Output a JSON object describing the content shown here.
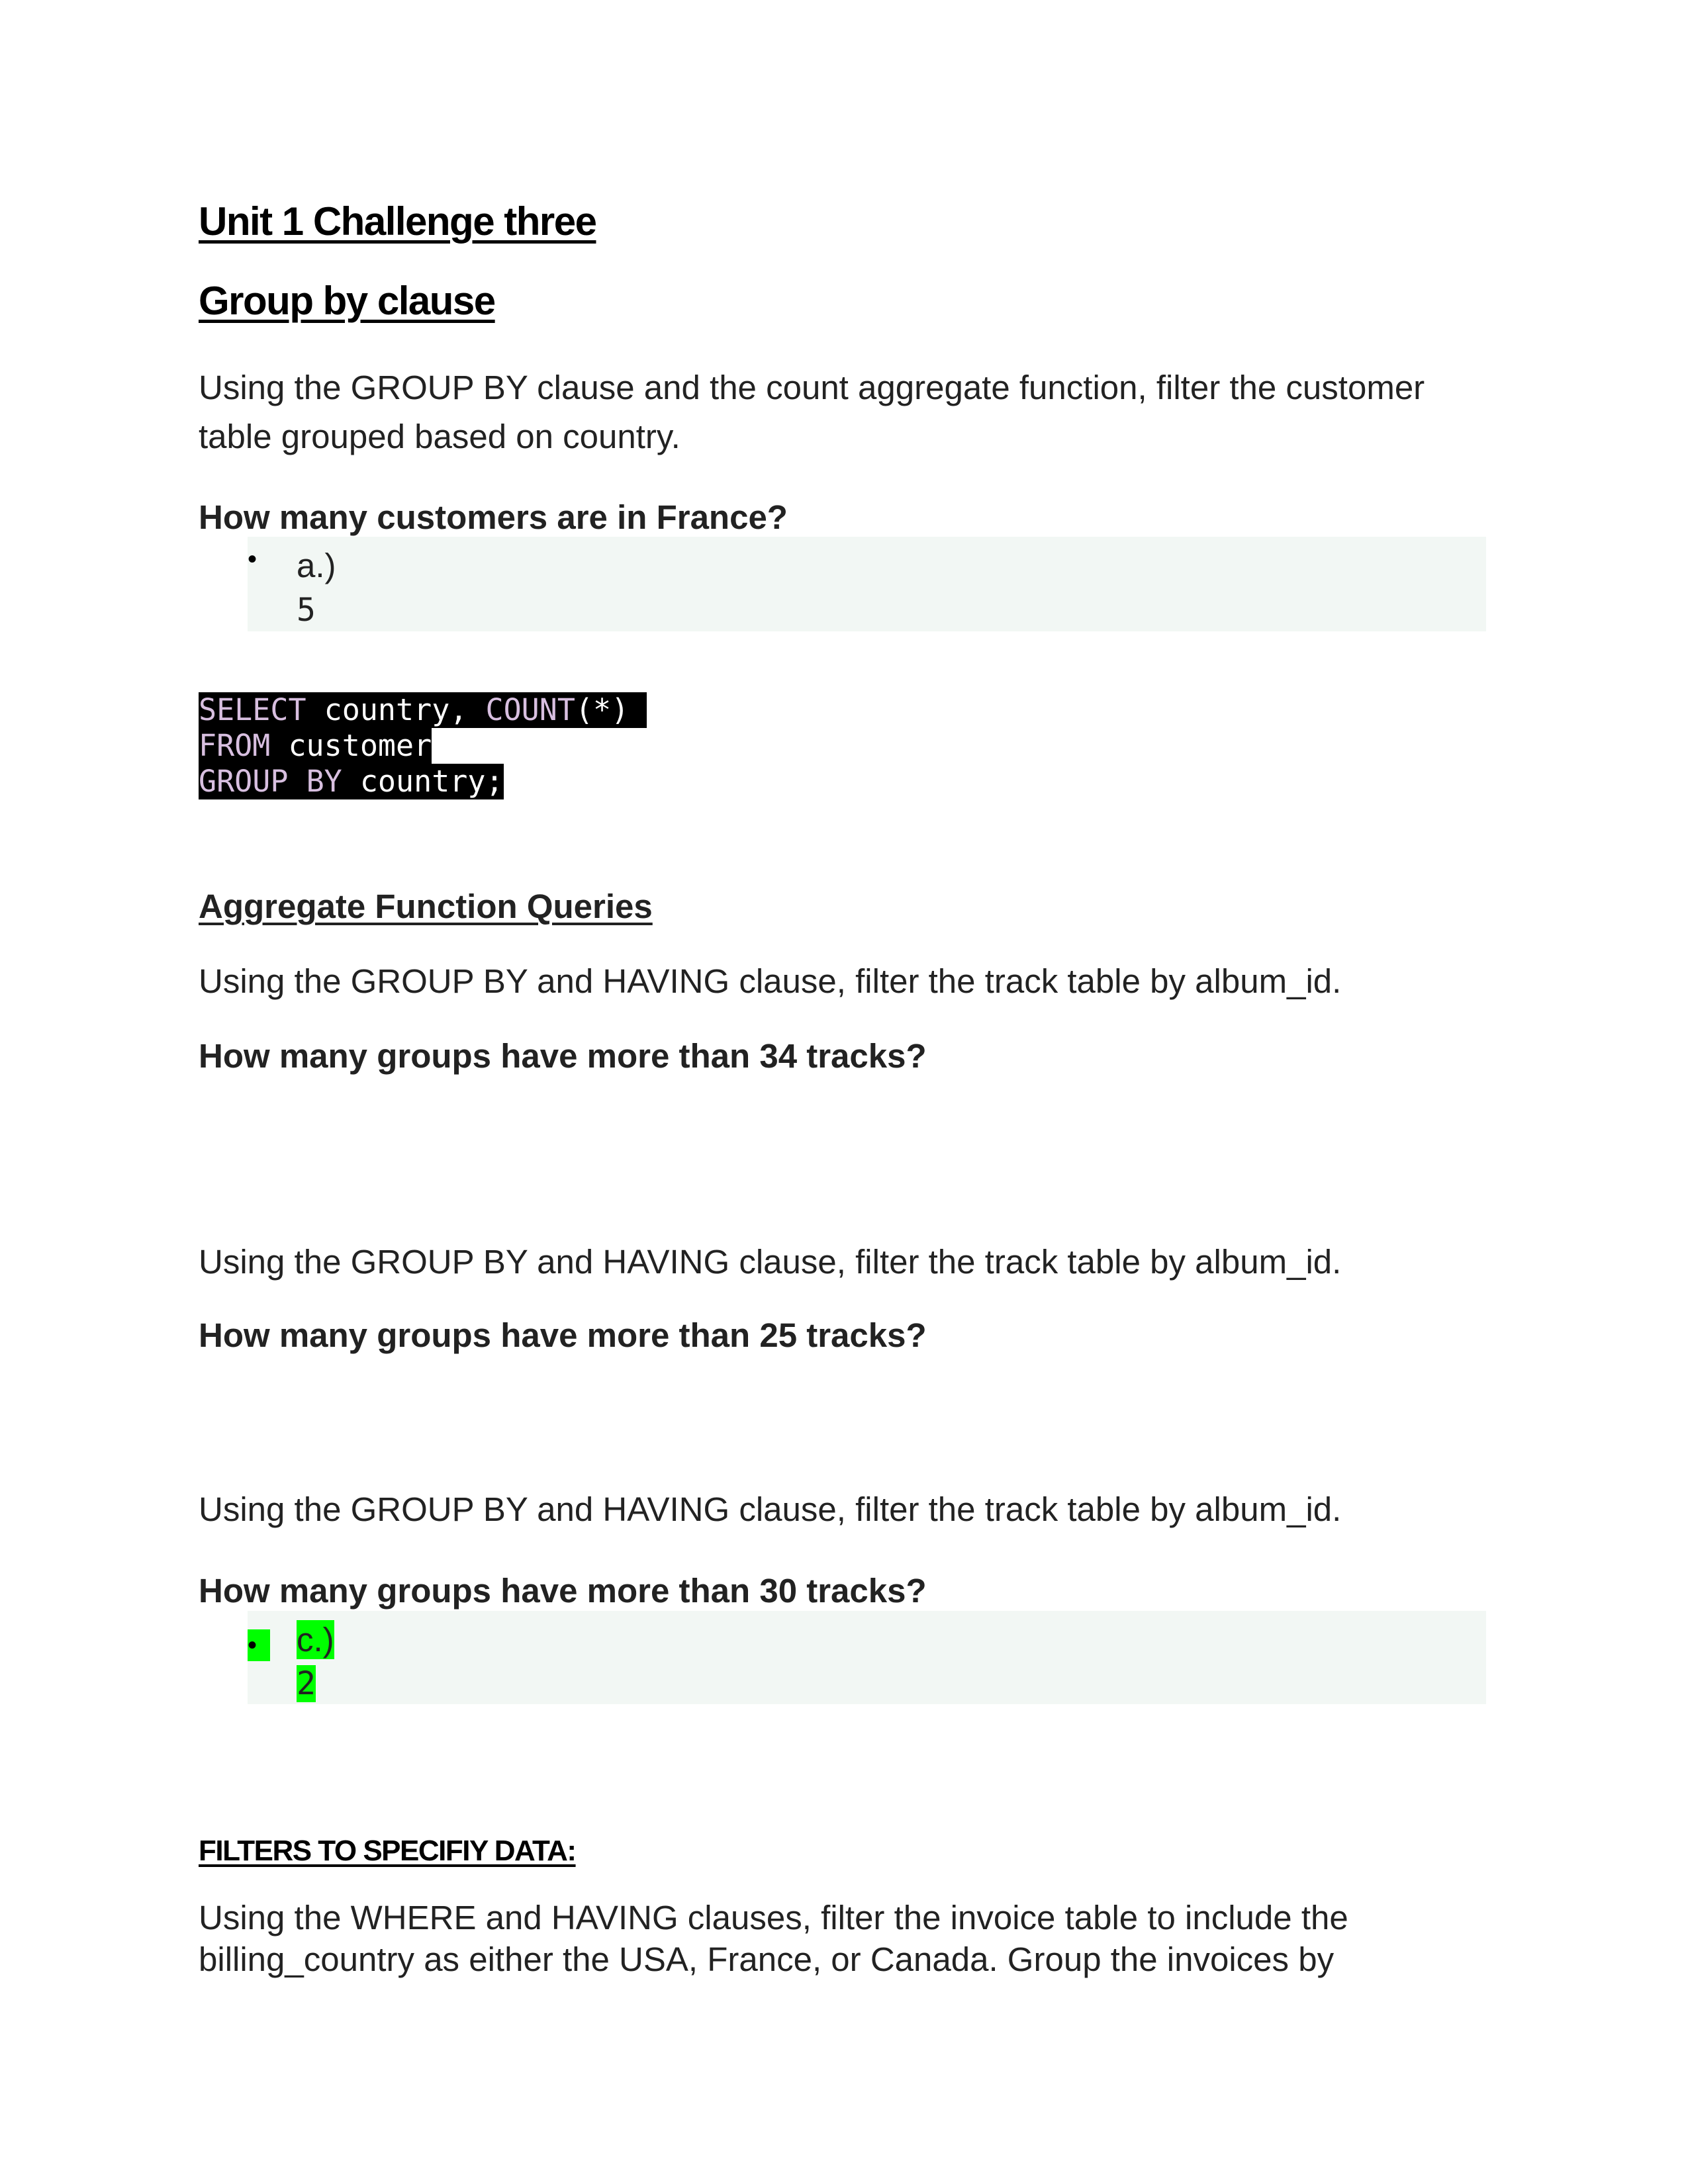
{
  "document": {
    "title": "Unit 1 Challenge three",
    "section1": {
      "heading": "Group by clause",
      "instruction_lines": [
        "Using the GROUP BY clause and the count aggregate function, filter the customer",
        "table grouped based on country."
      ],
      "question": "How many customers are in France?",
      "answer": {
        "label": "a.)",
        "value": "5",
        "highlighted": false
      },
      "code": {
        "line1": {
          "kw1": "SELECT",
          "rest1": " country, ",
          "kw2": "COUNT",
          "rest2": "(*) "
        },
        "line2": {
          "kw1": "FROM",
          "rest1": " customer"
        },
        "line3": {
          "kw1": "GROUP",
          "sp": " ",
          "kw2": "BY",
          "rest1": " country;"
        }
      }
    },
    "section2": {
      "heading": "Aggregate Function Queries",
      "blocks": [
        {
          "instruction": "Using the GROUP BY and HAVING clause, filter the track table by album_id.",
          "question": "How many groups have more than 34 tracks?"
        },
        {
          "instruction": "Using the GROUP BY and HAVING clause, filter the track table by album_id.",
          "question": "How many groups have more than 25 tracks?"
        },
        {
          "instruction": "Using the GROUP BY and HAVING clause, filter the track table by album_id.",
          "question": "How many groups have more than 30 tracks?",
          "answer": {
            "label": "c.)",
            "value": "2",
            "highlighted": true,
            "highlight_color": "#00ff00"
          }
        }
      ]
    },
    "section3": {
      "heading": "FILTERS TO SPECIFIY DATA:",
      "instruction_lines": [
        "Using the WHERE and HAVING clauses, filter the invoice table to include the",
        "billing_country as either the USA, France, or Canada. Group the invoices by"
      ]
    }
  }
}
